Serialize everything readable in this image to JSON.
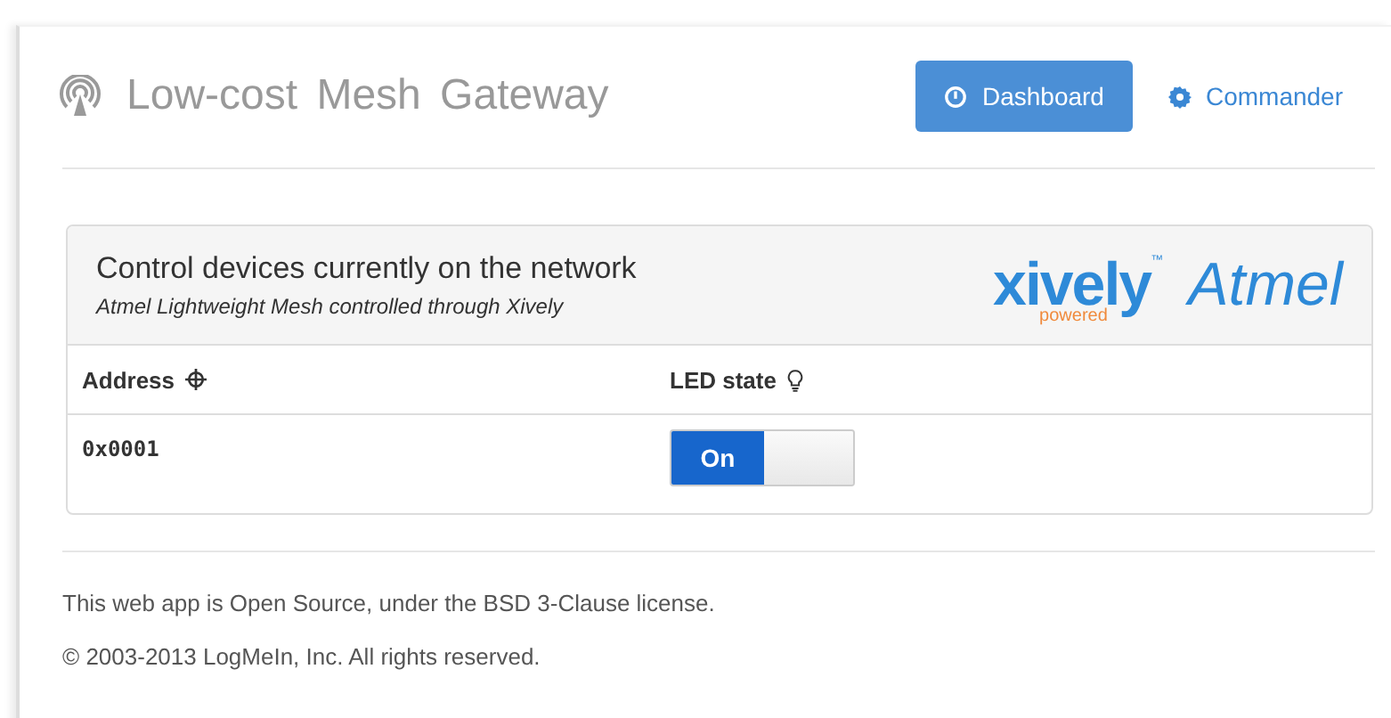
{
  "header": {
    "title": "Low-cost Mesh Gateway",
    "nav": [
      {
        "label": "Dashboard",
        "selected": true,
        "kind": "dashboard"
      },
      {
        "label": "Commander",
        "selected": false,
        "kind": "gear"
      }
    ]
  },
  "panel": {
    "title": "Control devices currently on the network",
    "subtitle": "Atmel Lightweight Mesh controlled through Xively",
    "logos": {
      "xively": "xively",
      "tm": "™",
      "powered": "powered",
      "atmel": "Atmel"
    },
    "columns": [
      {
        "label": "Address",
        "kind": "crosshair"
      },
      {
        "label": "LED state",
        "kind": "bulb"
      }
    ],
    "rows": [
      {
        "address": "0x0001",
        "led": {
          "label": "On",
          "on": true
        }
      }
    ]
  },
  "footer": [
    "This web app is Open Source, under the BSD 3-Clause license.",
    "© 2003-2013 LogMeIn, Inc. All rights reserved."
  ]
}
